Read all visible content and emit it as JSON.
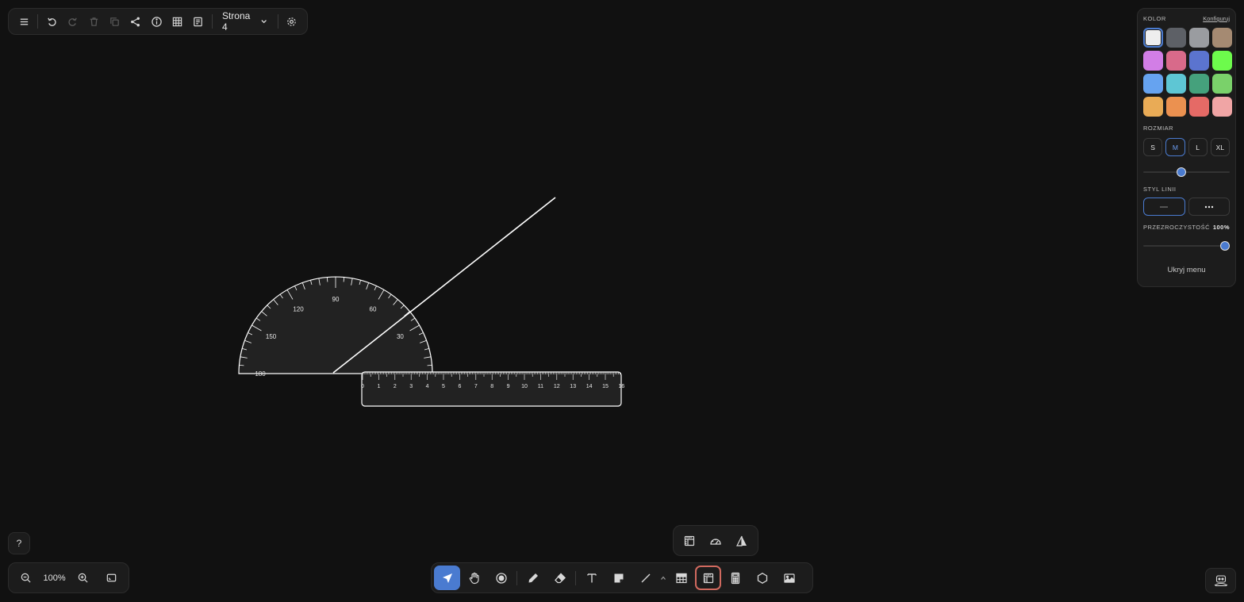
{
  "toolbar": {
    "page_label": "Strona 4"
  },
  "style_panel": {
    "color_title": "KOLOR",
    "configure_link": "Konfiguruj",
    "colors": [
      "#eeeeee",
      "#5d6066",
      "#9a9ca0",
      "#a58a72",
      "#d27ee6",
      "#d86a8a",
      "#5b74cf",
      "#6dfb4c",
      "#66a3f0",
      "#5ec6d4",
      "#45a17c",
      "#7ad16a",
      "#e9ab56",
      "#eb9150",
      "#e56a66",
      "#f0a5a5"
    ],
    "selected_color": 0,
    "size_title": "ROZMIAR",
    "sizes": [
      "S",
      "M",
      "L",
      "XL"
    ],
    "selected_size": "M",
    "size_slider_value": 0.44,
    "line_style_title": "STYL LINII",
    "opacity_title": "PRZEZROCZYSTOŚĆ",
    "opacity_value": "100%",
    "opacity_slider_value": 1.0,
    "hide_menu_label": "Ukryj menu",
    "accent_color": "#4a7bd0"
  },
  "help": {
    "label": "?"
  },
  "zoom": {
    "level": "100%"
  },
  "bottom_toolbar": {
    "active_tool": "select",
    "highlighted_tool": "geometry-tools",
    "highlight_color": "#d16a5f"
  },
  "protractor": {
    "labels": [
      "30",
      "60",
      "90",
      "120",
      "150",
      "180"
    ]
  },
  "ruler": {
    "labels": [
      "0",
      "1",
      "2",
      "3",
      "4",
      "5",
      "6",
      "7",
      "8",
      "9",
      "10",
      "11",
      "12",
      "13",
      "14",
      "15",
      "16"
    ]
  }
}
